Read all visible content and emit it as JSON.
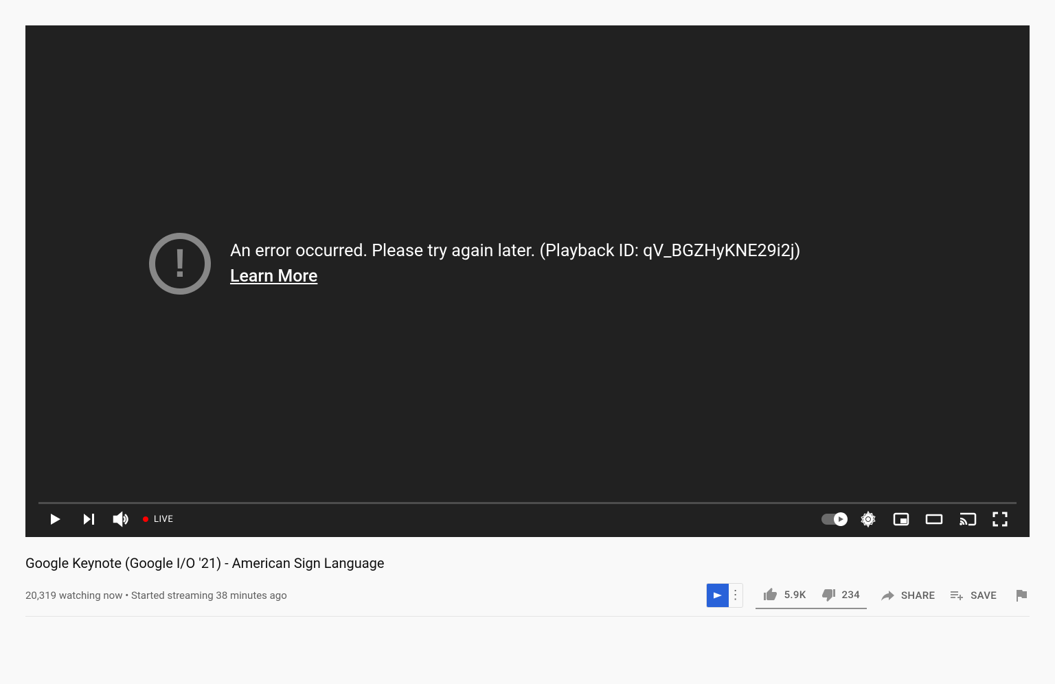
{
  "player": {
    "error_message": "An error occurred. Please try again later. (Playback ID: qV_BGZHyKNE29i2j)",
    "learn_more": "Learn More",
    "live_label": "LIVE"
  },
  "video": {
    "title": "Google Keynote (Google I/O '21) - American Sign Language",
    "watching_count": "20,319 watching now",
    "separator": " • ",
    "started": "Started streaming 38 minutes ago"
  },
  "actions": {
    "like_count": "5.9K",
    "dislike_count": "234",
    "share_label": "SHARE",
    "save_label": "SAVE"
  }
}
